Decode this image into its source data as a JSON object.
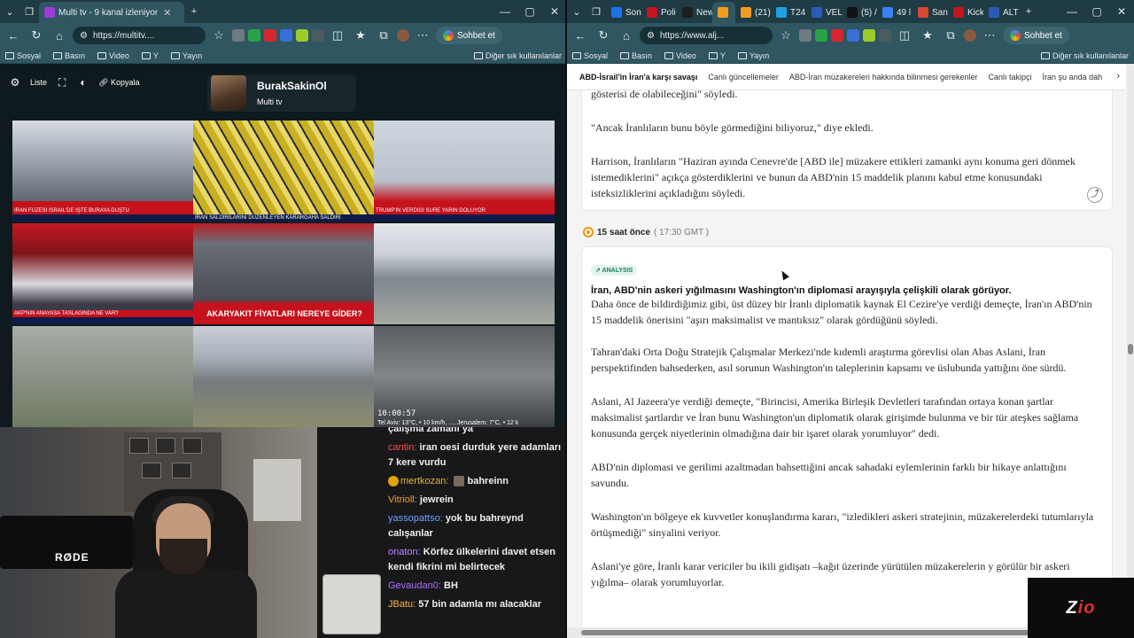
{
  "left_window": {
    "tabs": [
      {
        "label": "Multi tv - 9 kanal izleniyor",
        "fav": "#9b3fd6"
      }
    ],
    "url": "https://multitv....",
    "chat_button": "Sohbet et",
    "bookmarks": [
      "Sosyal",
      "Basın",
      "Video",
      "Y",
      "Yayın"
    ],
    "bookmarks_right": "Diğer sık kullanılanlar"
  },
  "right_window": {
    "tabs": [
      {
        "label": "Son",
        "fav": "#1a73e8"
      },
      {
        "label": "Poli",
        "fav": "#c4161c"
      },
      {
        "label": "New",
        "fav": "#1e1e1e"
      },
      {
        "label": "",
        "fav": "#f29d1f"
      },
      {
        "label": "(21)",
        "fav": "#f29d1f"
      },
      {
        "label": "T24",
        "fav": "#1fa0e3"
      },
      {
        "label": "VEL",
        "fav": "#2b5bb8"
      },
      {
        "label": "(5) /",
        "fav": "#111111"
      },
      {
        "label": "49 l",
        "fav": "#3b82f6"
      },
      {
        "label": "San",
        "fav": "#d94732"
      },
      {
        "label": "Kick",
        "fav": "#c4161c"
      },
      {
        "label": "ALT",
        "fav": "#2b5bb8"
      }
    ],
    "url": "https://www.alj...",
    "chat_button": "Sohbet et",
    "bookmarks": [
      "Sosyal",
      "Basın",
      "Video",
      "Y",
      "Yayın"
    ],
    "bookmarks_right": "Diğer sık kullanılanlar"
  },
  "multitv": {
    "controls": {
      "list": "Liste",
      "copy": "Kopyala"
    },
    "channel_name": "BurakSakinOl",
    "channel_sub": "Multi tv",
    "tickers": [
      "İRAN FÜZESİ İSRAİL'DE İŞTE BURAYA DÜŞTÜ",
      "İRAN SALDIRILARINI DÜZENLEYEN KARARGAHA SALDIRI",
      "TRUMP'IN VERDİĞİ SÜRE YARIN DOLUYOR",
      "AKP'NİN ANAYASA TASLAĞINDA NE VAR?",
      "AKARYAKIT FİYATLARI NEREYE GİDER?"
    ],
    "overlay_time": "10:00:57",
    "overlay_weather": "Tel Aviv: 13°C, • 10 km/h, ..., Jerusalem: 7°C, • 12 k",
    "cam_label": "RØDE"
  },
  "chat": [
    {
      "user": "",
      "color": "#efeff1",
      "text": "çalışma zamanı ya"
    },
    {
      "user": "cantin:",
      "color": "#ff4a4a",
      "text": "iran oesi durduk yere adamları 7 kere vurdu"
    },
    {
      "user": "mertkozan:",
      "color": "#e3b341",
      "text": "bahreinn",
      "badge": true
    },
    {
      "user": "Vitrioll:",
      "color": "#ff9f1a",
      "text": "jewrein"
    },
    {
      "user": "yassopattso:",
      "color": "#6aa3ff",
      "text": "yok bu bahreynd calışanlar"
    },
    {
      "user": "onaton:",
      "color": "#c87fff",
      "text": "Körfez ülkelerini davet etsen kendi fikrini mi belirtecek"
    },
    {
      "user": "Gevaudan0:",
      "color": "#b06cff",
      "text": "BH"
    },
    {
      "user": "JBatu:",
      "color": "#ffb347",
      "text": "57 bin adamla mı alacaklar"
    }
  ],
  "article": {
    "nav": [
      "ABD-İsrail'in İran'a karşı savaşı",
      "Canlı güncellemeler",
      "ABD-İran müzakereleri hakkında bilinmesi gerekenler",
      "Canlı takipçi",
      "İran şu anda dah"
    ],
    "card1": [
      "gösterisi de olabileceğini\" söyledi.",
      "\"Ancak İranlıların bunu böyle görmediğini biliyoruz,\" diye ekledi.",
      "Harrison, İranlıların \"Haziran ayında Cenevre'de [ABD ile] müzakere ettikleri zamanki aynı konuma geri dönmek istemediklerini\" açıkça gösterdiklerini ve bunun da ABD'nin 15 maddelik planını kabul etme konusundaki isteksizliklerini açıkladığını söyledi."
    ],
    "timestamp": "15 saat önce",
    "timestamp_gmt": "( 17:30 GMT )",
    "tag": "ANALYSIS",
    "headline": "İran, ABD'nin askeri yığılmasını Washington'ın diplomasi arayışıyla çelişkili olarak görüyor.",
    "paragraphs": [
      "Daha önce de bildirdiğimiz gibi, üst düzey bir İranlı diplomatik kaynak El Cezire'ye verdiği demeçte, İran'ın ABD'nin 15 maddelik önerisini \"aşırı maksimalist ve mantıksız\" olarak gördüğünü söyledi.",
      "Tahran'daki Orta Doğu Stratejik Çalışmalar Merkezi'nde kıdemli araştırma görevlisi olan Abas Aslani, İran perspektifinden bahsederken, asıl sorunun Washington'ın taleplerinin kapsamı ve üslubunda yattığını öne sürdü.",
      "Aslani, Al Jazeera'ye verdiği demeçte, \"Birincisi, Amerika Birleşik Devletleri tarafından ortaya konan şartlar maksimalist şartlardır ve İran bunu Washington'un diplomatik olarak girişimde bulunma ve bir tür ateşkes sağlama konusunda gerçek niyetlerinin olmadığına dair bir işaret olarak yorumluyor\" dedi.",
      "ABD'nin diplomasi ve gerilimi azaltmadan bahsettiğini ancak sahadaki eylemlerinin farklı bir hikaye anlattığını savundu.",
      "Washington'ın bölgeye ek kuvvetler konuşlandırma kararı, \"izledikleri askeri stratejinin, müzakerelerdeki tutumlarıyla örtüşmediği\" sinyalini veriyor.",
      "Aslani'ye göre, İranlı karar vericiler bu ikili gidişatı –kağıt üzerinde yürütülen müzakerelerin y görülür bir askeri yığılma– olarak yorumluyorlar."
    ]
  },
  "logo": {
    "text": "Z",
    "accent": "io"
  }
}
